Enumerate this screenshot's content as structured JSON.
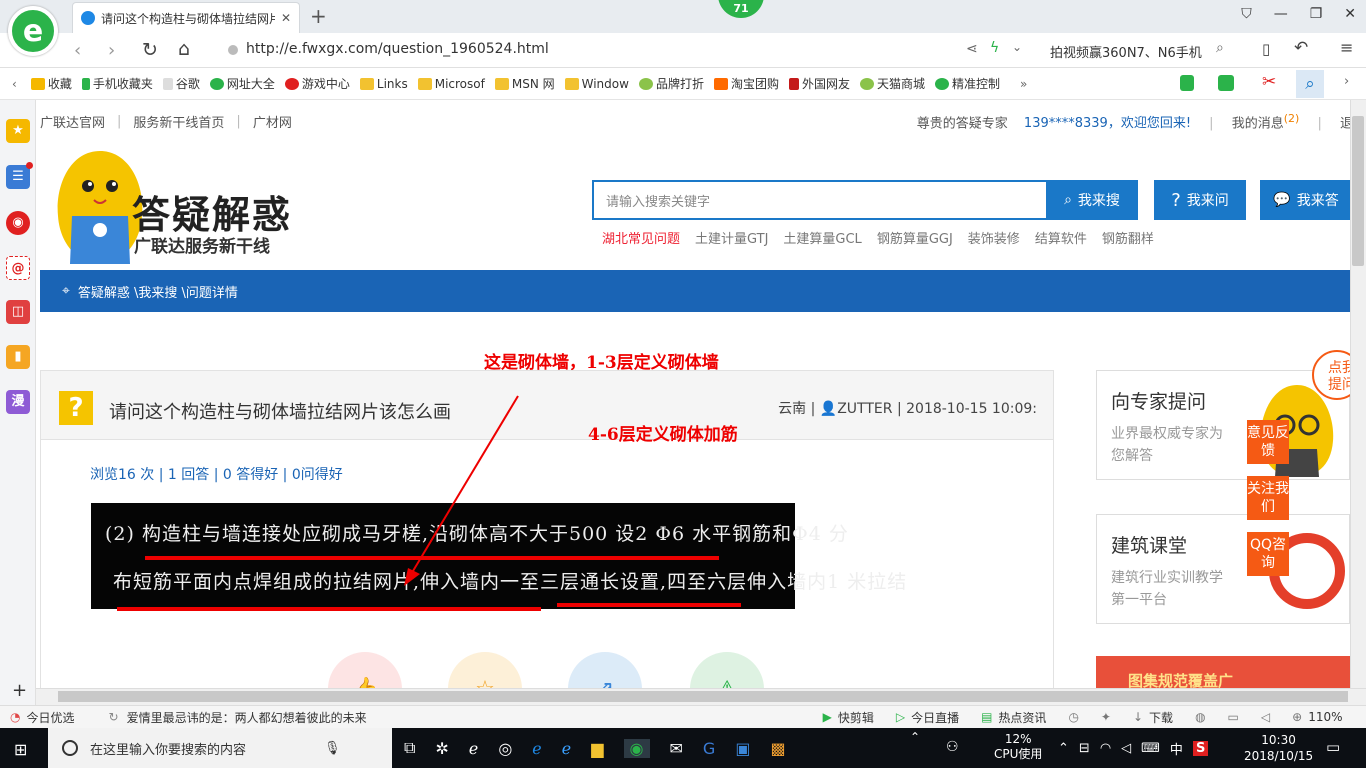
{
  "browser": {
    "tab_title": "请问这个构造柱与砌体墙拉结网片",
    "badge": "71",
    "url": "http://e.fwxgx.com/question_1960524.html",
    "search_hint": "拍视频赢360N7、N6手机"
  },
  "bookmarks": [
    "收藏",
    "手机收藏夹",
    "谷歌",
    "网址大全",
    "游戏中心",
    "Links",
    "Microsof",
    "MSN 网",
    "Window",
    "品牌打折",
    "淘宝团购",
    "外国网友",
    "天猫商城",
    "精准控制"
  ],
  "site": {
    "top_links": [
      "广联达官网",
      "服务新干线首页",
      "广材网"
    ],
    "expert_label": "尊贵的答疑专家",
    "welcome": "139****8339，欢迎您回来!",
    "messages_label": "我的消息",
    "messages_count": "(2)",
    "logout": "退出",
    "logo_title": "答疑解惑",
    "logo_subtitle": "广联达服务新干线",
    "search_placeholder": "请输入搜索关键字",
    "btn_search": "我来搜",
    "btn_ask": "我来问",
    "btn_answer": "我来答",
    "hot_words": [
      "湖北常见问题",
      "土建计量GTJ",
      "土建算量GCL",
      "钢筋算量GGJ",
      "装饰装修",
      "结算软件",
      "钢筋翻样"
    ],
    "breadcrumb": "答疑解惑 \\我来搜 \\问题详情"
  },
  "question": {
    "icon": "?",
    "title": "请问这个构造柱与砌体墙拉结网片该怎么画",
    "region": "云南",
    "user": "ZUTTER",
    "datetime": "2018-10-15 10:09:",
    "stats": "浏览16 次 | 1 回答 | 0 答得好 | 0问得好",
    "image_line1": "(2) 构造柱与墙连接处应砌成马牙槎,沿砌体高不大于500 设2 Φ6 水平钢筋和Φ4 分",
    "image_line2": "布短筋平面内点焊组成的拉结网片,伸入墙内一至三层通长设置,四至六层伸入墙内1 米拉结",
    "annotation1": "这是砌体墙，1-3层定义砌体墙",
    "annotation2": "4-6层定义砌体加筋"
  },
  "sidebar_right": {
    "card1_title": "向专家提问",
    "card1_desc": "业界最权威专家为您解答",
    "card2_title": "建筑课堂",
    "card2_desc": "建筑行业实训教学第一平台",
    "bubble": "点我提问",
    "float_btns": [
      "意见反馈",
      "关注我们",
      "QQ咨询"
    ],
    "banner_text": "图集规范覆盖广"
  },
  "statusbar": {
    "left": "今日优选",
    "news": "爱情里最忌讳的是：两人都幻想着彼此的未来",
    "items": [
      "快剪辑",
      "今日直播",
      "热点资讯",
      "下载"
    ],
    "zoom": "110%"
  },
  "taskbar": {
    "search_placeholder": "在这里输入你要搜索的内容",
    "cpu_value": "12%",
    "cpu_label": "CPU使用",
    "ime": "中",
    "time": "10:30",
    "date": "2018/10/15"
  }
}
